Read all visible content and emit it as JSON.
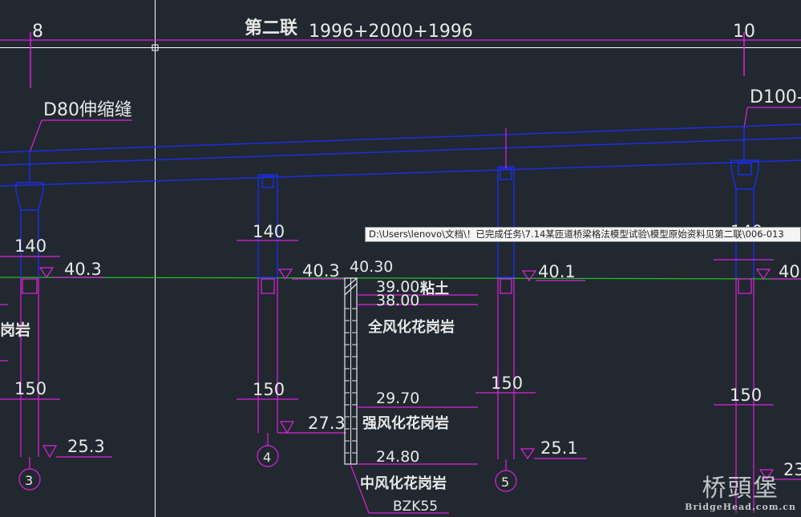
{
  "header": {
    "section_title": "第二联",
    "span_formula": "1996+2000+1996",
    "axis_left": "8",
    "axis_right": "10"
  },
  "joints": {
    "left": "D80伸缩缝",
    "right": "D100-"
  },
  "piers": [
    {
      "id": "3",
      "width_top": "140",
      "elev_top": "40.3",
      "width_bottom": "150",
      "elev_bottom": "25.3",
      "stratum_fragment": "岗岩"
    },
    {
      "id": "4",
      "width_top": "140",
      "elev_top": "40.3",
      "width_bottom": "150",
      "elev_bottom": "27.3"
    },
    {
      "id": "5",
      "elev_top": "40.1",
      "width_bottom": "150",
      "elev_bottom": "25.1"
    },
    {
      "id": "",
      "width_top": "140",
      "elev_top": "40",
      "width_bottom": "150",
      "elev_bottom": "23"
    }
  ],
  "borehole": {
    "id": "BZK55",
    "top_elev": "40.30",
    "layers": [
      {
        "elev": "39.00",
        "name": "粘土"
      },
      {
        "elev": "38.00",
        "name": "全风化花岗岩"
      },
      {
        "elev": "29.70",
        "name": "强风化花岗岩"
      },
      {
        "elev": "24.80",
        "name": "中风化花岗岩"
      }
    ]
  },
  "tooltip": {
    "path": "D:\\Users\\lenovo\\文档\\！已完成任务\\7.14某匝道桥梁格法模型试验\\模型原始资料见第二联\\006-013"
  },
  "watermark": {
    "logo": "桥頭堡",
    "site": "BridgeHead.com.cn"
  },
  "colors": {
    "background": "#212830",
    "magenta": "#e020e0",
    "blue": "#1a2ee0",
    "green": "#20c020",
    "white": "#ffffff"
  }
}
